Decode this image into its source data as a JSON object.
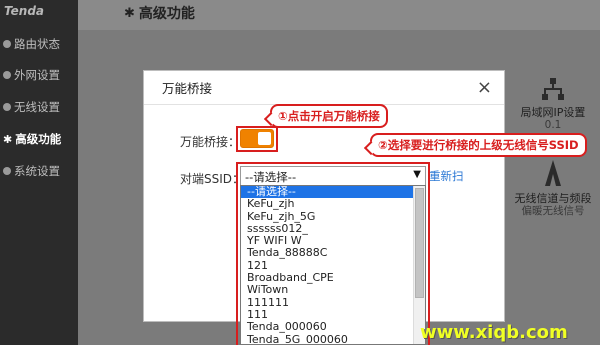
{
  "app": {
    "logo": "Tenda"
  },
  "sidebar": {
    "items": [
      {
        "label": "路由状态"
      },
      {
        "label": "外网设置"
      },
      {
        "label": "无线设置"
      },
      {
        "label": "高级功能",
        "active": true
      },
      {
        "label": "系统设置"
      }
    ]
  },
  "page": {
    "title": "高级功能"
  },
  "side_tools": [
    {
      "label": "局域网IP设置",
      "sub": "0.1",
      "icon": "network-icon"
    },
    {
      "label": "无线信道与频段",
      "sub": "偏暖无线信号",
      "icon": "antenna-icon"
    }
  ],
  "modal": {
    "title": "万能桥接",
    "bridge_label": "万能桥接：",
    "bridge_enabled": true,
    "ssid_label": "对端SSID：",
    "ssid_selected": "--请选择--",
    "rescan_label": "重新扫",
    "ssid_options": [
      "--请选择--",
      "KeFu_zjh",
      "KeFu_zjh_5G",
      "ssssss012_",
      "YF WIFI W",
      "Tenda_88888C",
      "121",
      "Broadband_CPE",
      "WiTown",
      "111111",
      "111",
      "Tenda_000060",
      "Tenda_5G_000060"
    ]
  },
  "callouts": {
    "step1": "①点击开启万能桥接",
    "step2": "②选择要进行桥接的上级无线信号SSID"
  },
  "watermark": "www.xiqb.com",
  "colors": {
    "accent": "#f08200",
    "highlight": "#d81e1e",
    "link": "#2a77d4",
    "selection": "#1e73e6"
  }
}
